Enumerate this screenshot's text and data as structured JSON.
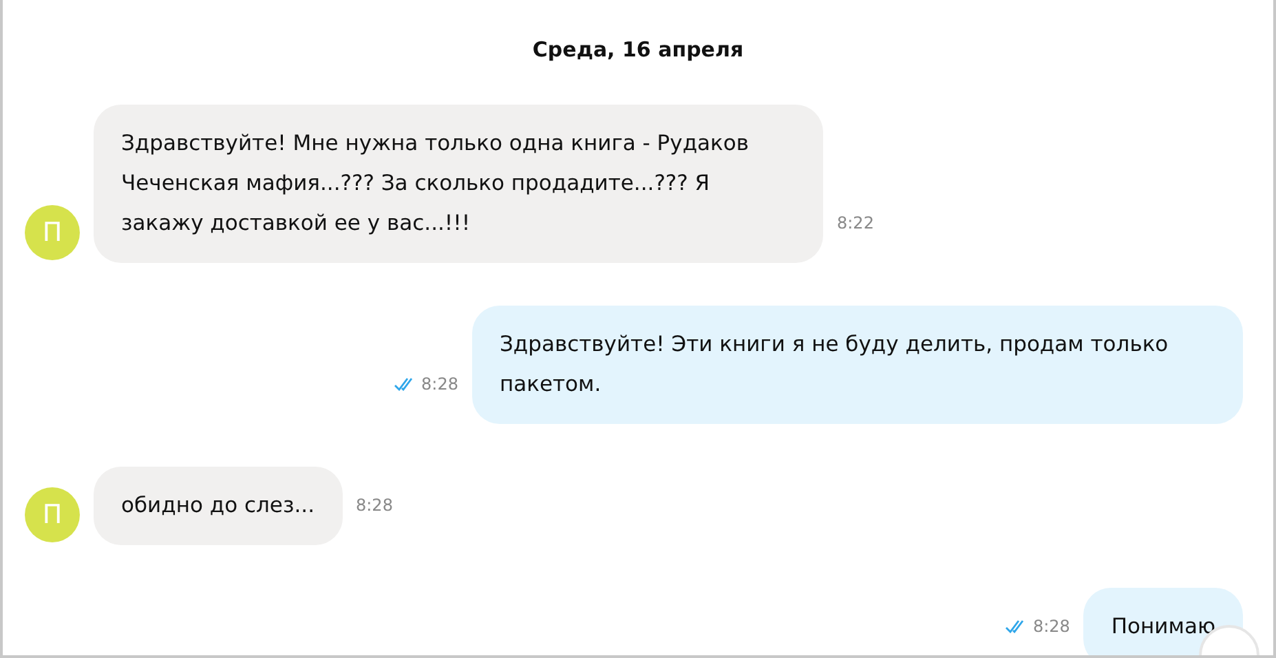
{
  "date_header": "Среда, 16 апреля",
  "messages": [
    {
      "kind": "incoming",
      "avatar": "П",
      "text": "Здравствуйте! Мне нужна только одна книга - Рудаков Чеченская мафия...??? За сколько продадите...??? Я закажу доставкой ее у вас...!!!",
      "time": "8:22"
    },
    {
      "kind": "outgoing",
      "text": "Здравствуйте! Эти книги я не буду делить, продам только пакетом.",
      "time": "8:28",
      "read": true
    },
    {
      "kind": "incoming",
      "avatar": "П",
      "text": "обидно до слез...",
      "time": "8:28"
    },
    {
      "kind": "outgoing",
      "text": "Понимаю",
      "time": "8:28",
      "read": true
    }
  ]
}
